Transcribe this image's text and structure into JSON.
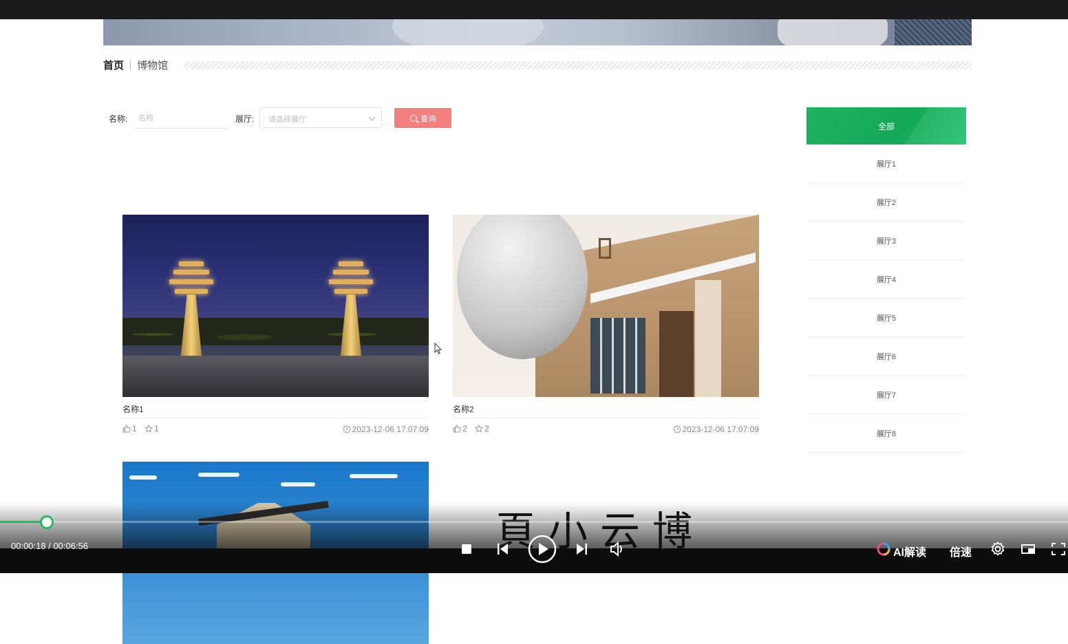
{
  "breadcrumb": {
    "home": "首页",
    "current": "博物馆"
  },
  "search": {
    "name_label": "名称:",
    "name_placeholder": "名称",
    "hall_label": "展厅:",
    "hall_placeholder": "请选择展厅",
    "query_label": "查询"
  },
  "cards": [
    {
      "title": "名称1",
      "likes": "1",
      "favorites": "1",
      "time": "2023-12-06 17:07:09"
    },
    {
      "title": "名称2",
      "likes": "2",
      "favorites": "2",
      "time": "2023-12-06 17:07:09"
    }
  ],
  "sidebar": {
    "all_label": "全部",
    "items": [
      "展厅1",
      "展厅2",
      "展厅3",
      "展厅4",
      "展厅5",
      "展厅6",
      "展厅7",
      "展厅8"
    ]
  },
  "player": {
    "time_display": "00:00:18 / 00:06:56",
    "progress": 0.043,
    "ai_label": "AI解读",
    "speed_label": "倍速",
    "overlay_text": "頁小云博"
  },
  "colors": {
    "accent_green": "#1fb262",
    "query_button": "#f47f7f",
    "progress_green": "#1fbd5c"
  },
  "icons": [
    "search-icon",
    "thumbs-up-icon",
    "star-icon",
    "clock-icon",
    "chevron-down-icon",
    "stop-icon",
    "previous-icon",
    "play-icon",
    "next-icon",
    "volume-icon",
    "settings-icon",
    "picture-in-picture-icon",
    "fullscreen-icon"
  ]
}
